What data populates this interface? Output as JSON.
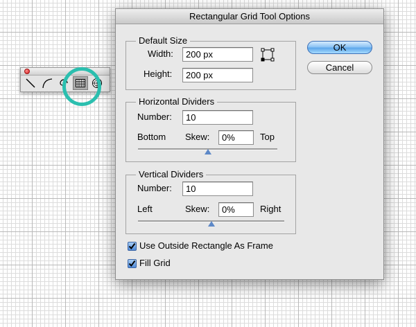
{
  "palette": {
    "tools": [
      {
        "name": "line-segment-tool-icon",
        "selected": false
      },
      {
        "name": "arc-tool-icon",
        "selected": false
      },
      {
        "name": "spiral-tool-icon",
        "selected": false
      },
      {
        "name": "rectangular-grid-tool-icon",
        "selected": true
      },
      {
        "name": "polar-grid-tool-icon",
        "selected": false
      }
    ],
    "highlight_color": "#2bbfaf"
  },
  "dialog": {
    "title": "Rectangular Grid Tool Options",
    "default_size": {
      "title": "Default Size",
      "width_label": "Width:",
      "width_value": "200 px",
      "height_label": "Height:",
      "height_value": "200 px"
    },
    "horizontal": {
      "title": "Horizontal Dividers",
      "number_label": "Number:",
      "number_value": "10",
      "left_label": "Bottom",
      "skew_label": "Skew:",
      "skew_value": "0%",
      "right_label": "Top",
      "skew_slider": 0.5
    },
    "vertical": {
      "title": "Vertical Dividers",
      "number_label": "Number:",
      "number_value": "10",
      "left_label": "Left",
      "skew_label": "Skew:",
      "skew_value": "0%",
      "right_label": "Right",
      "skew_slider": 0.5
    },
    "checkboxes": [
      {
        "label": "Use Outside Rectangle As Frame",
        "checked": true
      },
      {
        "label": "Fill Grid",
        "checked": true
      }
    ],
    "ok_label": "OK",
    "cancel_label": "Cancel"
  },
  "colors": {
    "accent_blue": "#5ea7ea",
    "highlight_teal": "#2bbfaf"
  }
}
